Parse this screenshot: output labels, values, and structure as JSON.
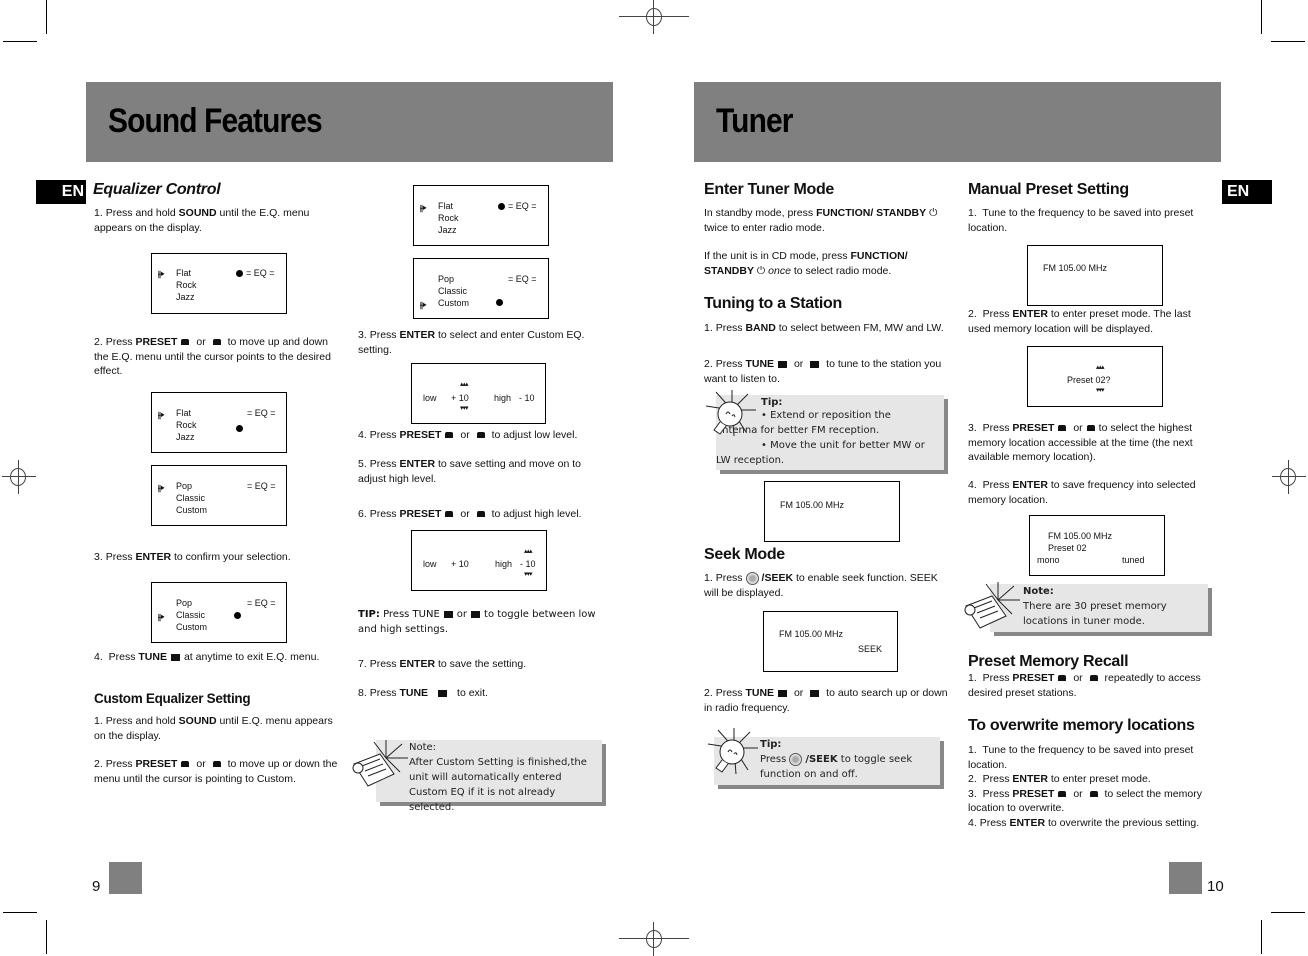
{
  "left_page": {
    "title": "Sound Features",
    "lang_tag": "EN",
    "page_number": "9",
    "equalizer": {
      "heading": "Equalizer Control",
      "step1": {
        "num": "1.",
        "pre": "Press and hold",
        "key": "SOUND",
        "post": "until the E.Q. menu appears on the display."
      },
      "step2": {
        "num": "2.",
        "pre": "Press",
        "key": "PRESET",
        "or": "or",
        "post": "to move up and down the E.Q. menu until the cursor points to the desired effect."
      },
      "step3": {
        "num": "3.",
        "pre": "Press",
        "key": "ENTER",
        "post": "to confirm your selection."
      },
      "step4": {
        "num": "4.",
        "pre": "Press",
        "key": "TUNE",
        "post": "at anytime to exit E.Q. menu."
      }
    },
    "lcd": {
      "eq_label": "= EQ =",
      "list_a": [
        "Flat",
        "Rock",
        "Jazz"
      ],
      "list_b": [
        "Pop",
        "Classic",
        "Custom"
      ]
    },
    "custom": {
      "heading": "Custom Equalizer Setting",
      "step1": {
        "num": "1.",
        "pre": "Press and hold",
        "key": "SOUND",
        "post": "until E.Q. menu appears on the display."
      },
      "step2": {
        "num": "2.",
        "pre": "Press",
        "key": "PRESET",
        "or": "or",
        "post": "to move up or down the menu until the cursor is pointing to Custom."
      },
      "step3": {
        "num": "3.",
        "pre": "Press",
        "key": "ENTER",
        "post": "to select and enter Custom EQ. setting."
      },
      "step4": {
        "num": "4.",
        "pre": "Press",
        "key": "PRESET",
        "or": "or",
        "post": "to  adjust low level."
      },
      "step5": {
        "num": "5.",
        "pre": "Press",
        "key": "ENTER",
        "post": "to save setting and move on to adjust high level."
      },
      "step6": {
        "num": "6.",
        "pre": "Press",
        "key": "PRESET",
        "or": "or",
        "post": "to  adjust high level."
      },
      "tip": {
        "label": "TIP:",
        "pre": "Press TUNE",
        "or": "or",
        "post": "to toggle between low and high settings."
      },
      "step7": {
        "num": "7.",
        "pre": "Press",
        "key": "ENTER",
        "post": "to save the setting."
      },
      "step8": {
        "num": "8.",
        "pre": "Press",
        "key": "TUNE",
        "post": "to exit."
      },
      "level_lcd": {
        "low_label": "low",
        "low_value": "+ 10",
        "high_label": "high",
        "high_value": "- 10"
      },
      "note": {
        "label": "Note:",
        "text": "After Custom Setting is finished,the unit will automatically entered Custom EQ if it is not already selected."
      }
    }
  },
  "right_page": {
    "title": "Tuner",
    "lang_tag": "EN",
    "page_number": "10",
    "enter_tuner": {
      "heading": "Enter Tuner Mode",
      "para1": {
        "pre": "In standby mode, press",
        "key": "FUNCTION/ STANDBY",
        "post": "twice to enter radio mode."
      },
      "para2": {
        "pre": "If the unit is in CD mode, press",
        "key": "FUNCTION/ STANDBY",
        "em": "once",
        "post": "to select radio mode."
      }
    },
    "tuning": {
      "heading": "Tuning to a Station",
      "step1": {
        "num": "1.",
        "pre": "Press",
        "key": "BAND",
        "post": "to select between FM, MW and  LW."
      },
      "step2": {
        "num": "2.",
        "pre": "Press",
        "key": "TUNE",
        "or": "or",
        "post": "to tune to the station you want to listen to."
      },
      "tip": {
        "label": "Tip:",
        "line1": "•  Extend or reposition the antenna for better FM reception.",
        "line2": "•  Move the unit for better MW or LW reception."
      },
      "lcd_freq": "FM 105.00 MHz"
    },
    "seek": {
      "heading": "Seek Mode",
      "step1": {
        "num": "1.",
        "pre": "Press",
        "key": "/SEEK",
        "post": "to enable seek function.  SEEK will be displayed."
      },
      "lcd_freq": "FM 105.00 MHz",
      "lcd_seek": "SEEK",
      "step2": {
        "num": "2.",
        "pre": "Press",
        "key": "TUNE",
        "or": "or",
        "post": "to auto search up or down in radio  frequency."
      },
      "tip": {
        "label": "Tip:",
        "pre": "Press",
        "key": "/SEEK",
        "post": "to toggle seek function on and off."
      }
    },
    "manual_preset": {
      "heading": "Manual Preset Setting",
      "step1": {
        "num": "1.",
        "text": "Tune to the frequency to be saved into preset location."
      },
      "lcd1_freq": "FM 105.00 MHz",
      "step2": {
        "num": "2.",
        "pre": "Press",
        "key": "ENTER",
        "post": "to enter preset mode. The last used memory location will be displayed."
      },
      "lcd2_text": "Preset 02?",
      "step3": {
        "num": "3.",
        "pre": "Press",
        "key": "PRESET",
        "or": "or",
        "post": "to select the highest memory location accessible at the time (the next available memory location)."
      },
      "step4": {
        "num": "4.",
        "pre": "Press",
        "key": "ENTER",
        "post": "to save frequency into selected memory location."
      },
      "lcd3": {
        "freq": "FM 105.00 MHz",
        "preset": "Preset 02",
        "mode": "mono",
        "status": "tuned"
      },
      "note": {
        "label": "Note:",
        "text": "There are 30 preset memory locations in tuner mode."
      }
    },
    "recall": {
      "heading": "Preset Memory Recall",
      "step1": {
        "num": "1.",
        "pre": "Press",
        "key": "PRESET",
        "or": "or",
        "post": "repeatedly to  access desired preset stations."
      }
    },
    "overwrite": {
      "heading": "To overwrite memory locations",
      "step1": {
        "num": "1.",
        "text": "Tune to the frequency to be saved into preset location."
      },
      "step2": {
        "num": "2.",
        "pre": "Press",
        "key": "ENTER",
        "post": "to enter preset mode."
      },
      "step3": {
        "num": "3.",
        "pre": "Press",
        "key": "PRESET",
        "or": "or",
        "post": "to select the memory location to overwrite."
      },
      "step4": {
        "num": "4.",
        "pre": "Press",
        "key": "ENTER",
        "post": "to overwrite the previous setting."
      }
    }
  }
}
